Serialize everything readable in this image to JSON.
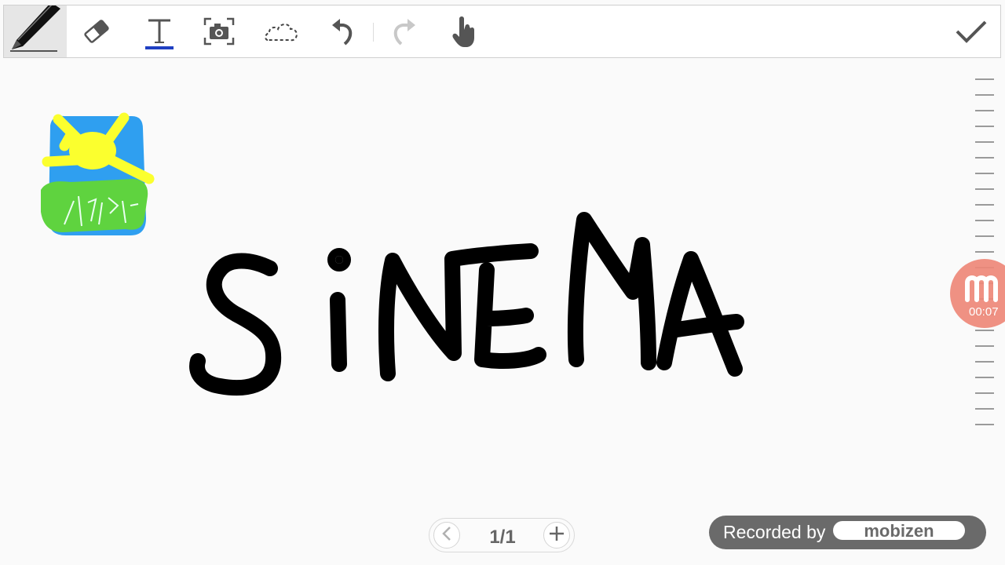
{
  "toolbar": {
    "tools": [
      {
        "name": "pen",
        "icon": "pen-icon",
        "selected": true
      },
      {
        "name": "eraser",
        "icon": "eraser-icon"
      },
      {
        "name": "text",
        "icon": "text-icon",
        "glyph": "T"
      },
      {
        "name": "image",
        "icon": "camera-capture-icon"
      },
      {
        "name": "lasso",
        "icon": "lasso-select-icon"
      },
      {
        "name": "undo",
        "icon": "undo-icon"
      },
      {
        "name": "redo",
        "icon": "redo-icon",
        "disabled": true
      },
      {
        "name": "hand",
        "icon": "hand-pointer-icon"
      }
    ],
    "done": {
      "icon": "checkmark-icon"
    },
    "accent": "#1f3fc2"
  },
  "canvas": {
    "handwritten_word": "SiNEMA",
    "sticker_scribble_text": "사진첩",
    "ink_color": "#000000",
    "sticker_colors": {
      "background": "#2f9ff0",
      "sun": "#fbff2e",
      "grass": "#5fd33f"
    }
  },
  "recorder": {
    "elapsed": "00:07",
    "icon": "mobizen-m-icon",
    "color": "#ee8878"
  },
  "pager": {
    "page_label": "1/1",
    "prev_icon": "chevron-left-icon",
    "add_icon": "plus-icon"
  },
  "watermark": {
    "prefix": "Recorded by",
    "brand": "mobizen"
  }
}
